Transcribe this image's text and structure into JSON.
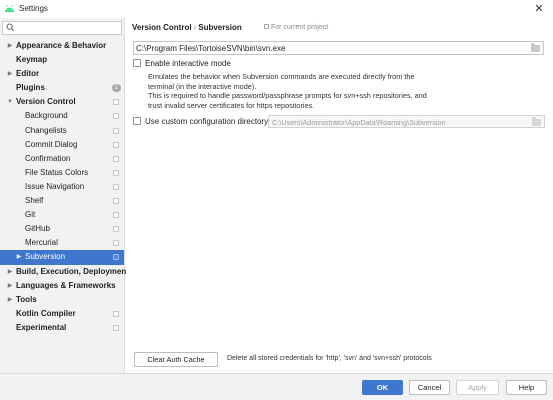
{
  "window": {
    "title": "Settings",
    "close_glyph": "✕",
    "icon": "android-icon"
  },
  "sidebar": {
    "search": {
      "value": "",
      "icon": "search-icon"
    },
    "items": [
      {
        "label": "Appearance & Behavior",
        "bold": true,
        "arrow": "▶",
        "child": false
      },
      {
        "label": "Keymap",
        "bold": true,
        "arrow": "",
        "child": false
      },
      {
        "label": "Editor",
        "bold": true,
        "arrow": "▶",
        "child": false
      },
      {
        "label": "Plugins",
        "bold": true,
        "arrow": "",
        "child": false,
        "badge": "1"
      },
      {
        "label": "Version Control",
        "bold": true,
        "arrow": "▼",
        "child": false,
        "proj": true
      },
      {
        "label": "Background",
        "child": true,
        "proj": true
      },
      {
        "label": "Changelists",
        "child": true,
        "proj": true
      },
      {
        "label": "Commit Dialog",
        "child": true,
        "proj": true
      },
      {
        "label": "Confirmation",
        "child": true,
        "proj": true
      },
      {
        "label": "File Status Colors",
        "child": true,
        "proj": true
      },
      {
        "label": "Issue Navigation",
        "child": true,
        "proj": true
      },
      {
        "label": "Shelf",
        "child": true,
        "proj": true
      },
      {
        "label": "Git",
        "child": true,
        "proj": true
      },
      {
        "label": "GitHub",
        "child": true,
        "proj": true
      },
      {
        "label": "Mercurial",
        "child": true,
        "proj": true
      },
      {
        "label": "Subversion",
        "child": true,
        "arrow": "▶",
        "proj": true,
        "selected": true
      },
      {
        "label": "Build, Execution, Deployment",
        "bold": true,
        "arrow": "▶",
        "child": false
      },
      {
        "label": "Languages & Frameworks",
        "bold": true,
        "arrow": "▶",
        "child": false
      },
      {
        "label": "Tools",
        "bold": true,
        "arrow": "▶",
        "child": false
      },
      {
        "label": "Kotlin Compiler",
        "bold": true,
        "arrow": "",
        "child": false,
        "proj": true
      },
      {
        "label": "Experimental",
        "bold": true,
        "arrow": "",
        "child": false,
        "proj": true
      }
    ]
  },
  "main": {
    "breadcrumb": {
      "parent": "Version Control",
      "sep": "›",
      "current": "Subversion"
    },
    "for_project": "For current project",
    "svn_path": "C:\\Program Files\\TortoiseSVN\\bin\\svn.exe",
    "interactive": {
      "label": "Enable interactive mode",
      "checked": false,
      "description": [
        "Emulates the behavior when Subversion commands are executed directly from the",
        "terminal (in the interactive mode).",
        "This is required to handle password/passphrase prompts for svn+ssh repositories, and",
        "trust invalid server certificates for https repositories."
      ]
    },
    "custom_config": {
      "label": "Use custom configuration directory:",
      "checked": false,
      "value": "C:\\Users\\Administrator\\AppData\\Roaming\\Subversion"
    },
    "clear_cache": {
      "button": "Clear Auth Cache",
      "description": "Delete all stored credentials for 'http', 'svn' and 'svn+ssh' protocols"
    }
  },
  "footer": {
    "ok": "OK",
    "cancel": "Cancel",
    "apply": "Apply",
    "help": "Help"
  },
  "colors": {
    "accent": "#3f77cf",
    "sidebar_bg": "#f2f2f2"
  }
}
